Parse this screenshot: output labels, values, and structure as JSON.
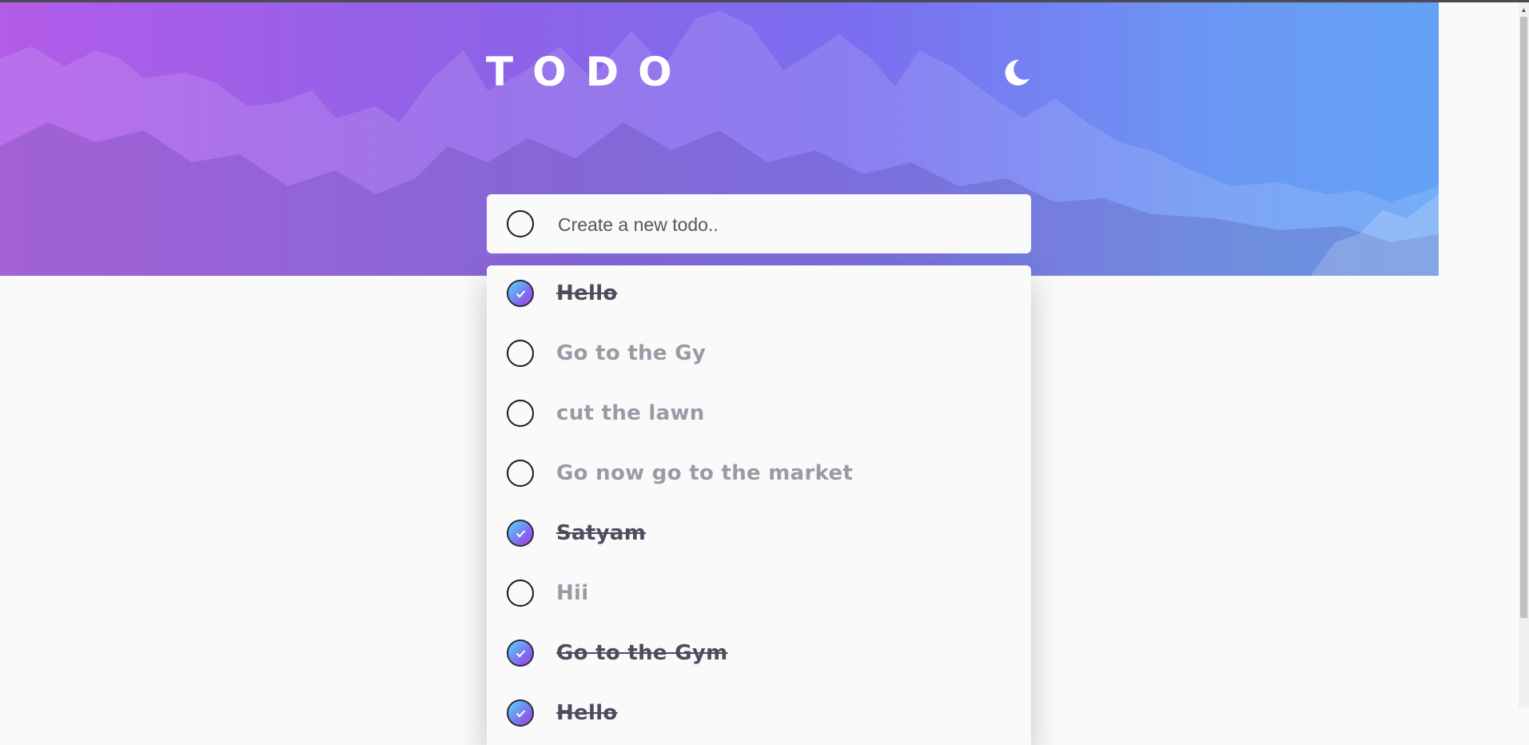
{
  "header": {
    "title": "TODO",
    "theme_toggle_icon": "moon-icon"
  },
  "new_todo": {
    "placeholder": "Create a new todo..",
    "value": ""
  },
  "todos": [
    {
      "text": "Hello",
      "completed": true
    },
    {
      "text": "Go to the Gy",
      "completed": false
    },
    {
      "text": "cut the lawn",
      "completed": false
    },
    {
      "text": "Go now go to the market",
      "completed": false
    },
    {
      "text": "Satyam",
      "completed": true
    },
    {
      "text": "Hii",
      "completed": false
    },
    {
      "text": "Go to the Gym",
      "completed": true
    },
    {
      "text": "Hello",
      "completed": true
    }
  ],
  "colors": {
    "gradient_start": "#57ddff",
    "gradient_end": "#c058f3",
    "hero_left": "#b25ce9",
    "hero_right": "#64a2f6"
  }
}
